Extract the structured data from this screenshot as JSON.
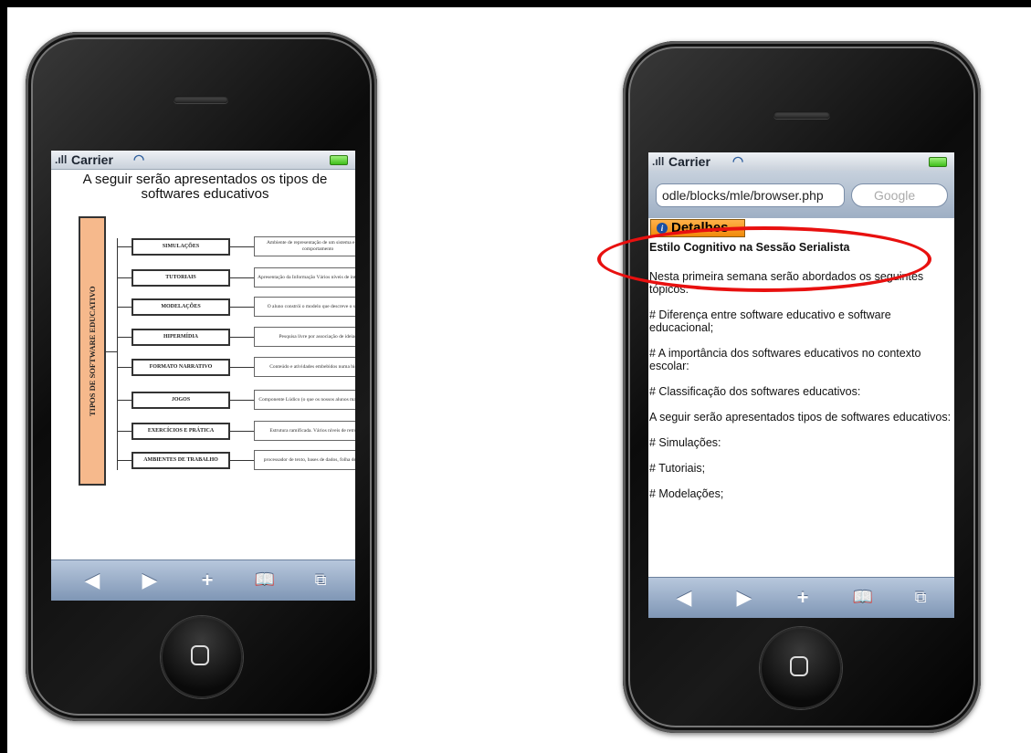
{
  "left_phone": {
    "status": {
      "carrier": "Carrier"
    },
    "title": "A seguir serão apresentados os tipos de softwares educativos",
    "diagram": {
      "root_label": "TIPOS DE SOFTWARE EDUCATIVO",
      "rows": [
        {
          "category": "SIMULAÇÕES",
          "description": "Ambiente de representação de um sistema e do seu comportamento"
        },
        {
          "category": "TUTORIAIS",
          "description": "Apresentação da Informação Vários níveis de interatividade"
        },
        {
          "category": "MODELAÇÕES",
          "description": "O aluno constrói o modelo que descreve o sistema"
        },
        {
          "category": "HIPERMÍDIA",
          "description": "Pesquisa livre por associação de ideias"
        },
        {
          "category": "FORMATO NARRATIVO",
          "description": "Conteúdo e atividades embebidos numa história"
        },
        {
          "category": "JOGOS",
          "description": "Componente Lúdico (o que os nossos alunos mais gostam)"
        },
        {
          "category": "EXERCÍCIOS E PRÁTICA",
          "description": "Estrutura ramificada. Vários níveis de retroação"
        },
        {
          "category": "AMBIENTES DE TRABALHO",
          "description": "processador de texto, bases de dados, folha de cálculo"
        }
      ]
    }
  },
  "right_phone": {
    "status": {
      "carrier": "Carrier"
    },
    "url": "odle/blocks/mle/browser.php",
    "search_placeholder": "Google",
    "details_button": "Detalhes",
    "heading": "Estilo Cognitivo na Sessão Serialista",
    "paragraphs": [
      "Nesta primeira semana serão abordados os seguintes tópicos:",
      "# Diferença entre software educativo e software educacional;",
      "# A importância dos softwares educativos no contexto escolar:",
      "# Classificação dos softwares educativos:",
      "A seguir serão apresentados tipos de softwares educativos:",
      "# Simulações:",
      "# Tutoriais;",
      "# Modelações;"
    ]
  },
  "toolbar_icons": [
    "back-icon",
    "forward-icon",
    "add-icon",
    "bookmarks-icon",
    "pages-icon"
  ],
  "colors": {
    "highlight_ellipse": "#e8100f",
    "details_button": "#f5a023",
    "toolbar": "#8ea3c0",
    "root_box": "#f6b98c"
  }
}
